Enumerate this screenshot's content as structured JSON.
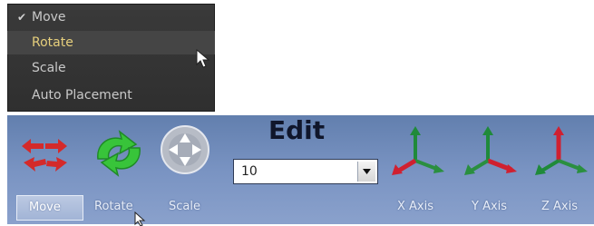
{
  "menu": {
    "items": [
      {
        "label": "Move",
        "checked": true
      },
      {
        "label": "Rotate",
        "highlighted": true
      },
      {
        "label": "Scale"
      },
      {
        "label": "Auto Placement"
      }
    ],
    "highlight_color": "#e6cf7c"
  },
  "toolbar": {
    "title": "Edit",
    "combo_value": "10",
    "tools": [
      {
        "label": "Move",
        "icon": "move-arrows-icon",
        "active": true
      },
      {
        "label": "Rotate",
        "icon": "rotate-green-icon"
      },
      {
        "label": "Scale",
        "icon": "scale-circle-icon"
      }
    ],
    "axes": [
      {
        "label": "X Axis",
        "icon": "x-axis-gizmo-icon"
      },
      {
        "label": "Y Axis",
        "icon": "y-axis-gizmo-icon"
      },
      {
        "label": "Z Axis",
        "icon": "z-axis-gizmo-icon"
      }
    ]
  }
}
